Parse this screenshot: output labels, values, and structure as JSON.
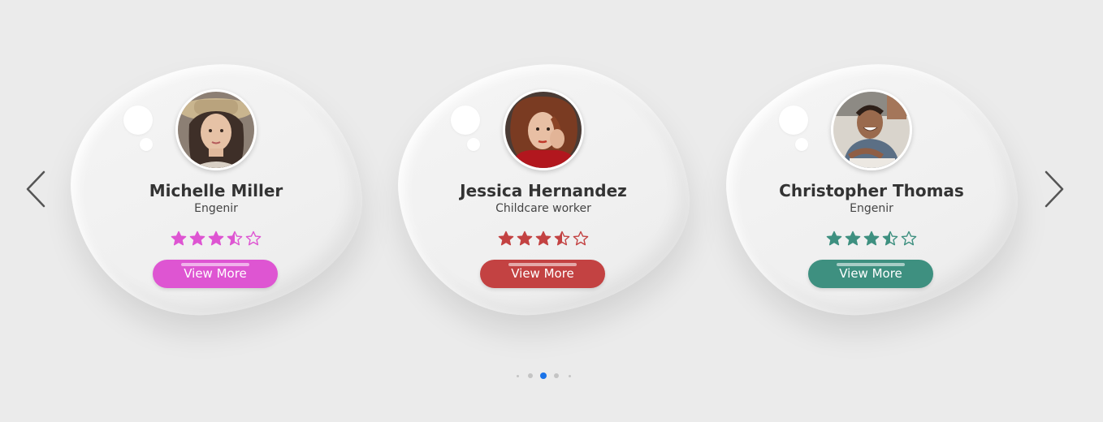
{
  "accent_colors": {
    "pink": "#de55d2",
    "red": "#c34242",
    "teal": "#3e9080",
    "pagination_active": "#1a73e8"
  },
  "navigation": {
    "prev_icon": "chevron-left-icon",
    "next_icon": "chevron-right-icon"
  },
  "cards": [
    {
      "name": "Michelle Miller",
      "role": "Engenir",
      "rating": 3.5,
      "rating_max": 5,
      "button_label": "View More",
      "color": "#de55d2",
      "avatar_icon": "user-avatar-photo"
    },
    {
      "name": "Jessica Hernandez",
      "role": "Childcare worker",
      "rating": 3.5,
      "rating_max": 5,
      "button_label": "View More",
      "color": "#c34242",
      "avatar_icon": "user-avatar-photo"
    },
    {
      "name": "Christopher Thomas",
      "role": "Engenir",
      "rating": 3.5,
      "rating_max": 5,
      "button_label": "View More",
      "color": "#3e9080",
      "avatar_icon": "user-avatar-photo"
    }
  ],
  "pagination": {
    "total": 5,
    "active_index": 2
  }
}
